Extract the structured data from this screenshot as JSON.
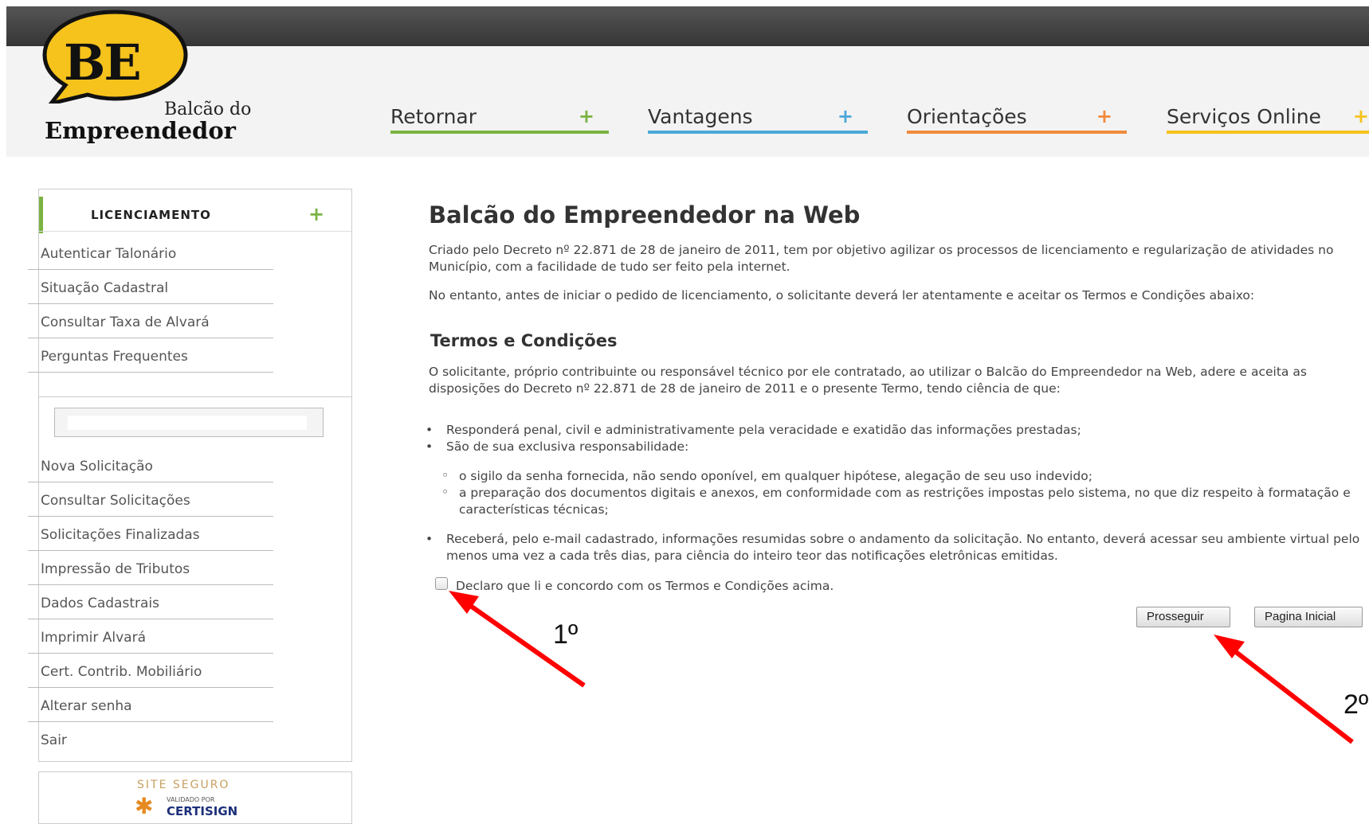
{
  "brand": {
    "logo_mark": "BE",
    "logo_line1": "Balcão do",
    "logo_line2": "Empreendedor",
    "bubble_color": "#f6c21c"
  },
  "nav": [
    {
      "label": "Retornar",
      "color": "#7ab342"
    },
    {
      "label": "Vantagens",
      "color": "#4aa8d8"
    },
    {
      "label": "Orientações",
      "color": "#f08a3b"
    },
    {
      "label": "Serviços Online",
      "color": "#f6c21c"
    }
  ],
  "nav_plus": "+",
  "sidebar": {
    "section_title": "LICENCIAMENTO",
    "section_plus": "+",
    "items_top": [
      "Autenticar Talonário",
      "Situação Cadastral",
      "Consultar Taxa de Alvará",
      "Perguntas Frequentes"
    ],
    "items_bottom": [
      "Nova Solicitação",
      "Consultar Solicitações",
      "Solicitações Finalizadas",
      "Impressão de Tributos",
      "Dados Cadastrais",
      "Imprimir Alvará",
      "Cert. Contrib. Mobiliário",
      "Alterar senha",
      "Sair"
    ],
    "seal_line1": "SITE SEGURO",
    "seal_line2": "VALIDADO POR",
    "seal_line3": "CERTISIGN"
  },
  "main": {
    "title": "Balcão do Empreendedor na Web",
    "para1": "Criado pelo Decreto nº 22.871 de 28 de janeiro de 2011, tem por objetivo agilizar os processos de licenciamento e regularização de atividades no Município, com a facilidade de tudo ser feito pela internet.",
    "para2": "No entanto, antes de iniciar o pedido de licenciamento, o solicitante deverá ler atentamente e aceitar os Termos e Condições abaixo:",
    "terms_title": "Termos e Condições",
    "para3": "O solicitante, próprio contribuinte ou responsável técnico por ele contratado, ao utilizar o Balcão do Empreendedor na Web, adere e aceita as disposições do Decreto nº 22.871 de 28 de janeiro de 2011 e o presente Termo, tendo ciência de que:",
    "bullet1": "Responderá penal, civil e administrativamente pela veracidade e exatidão das informações prestadas;",
    "bullet2": "São de sua exclusiva responsabilidade:",
    "sub1": "o sigilo da senha fornecida, não sendo oponível, em qualquer hipótese, alegação de seu uso indevido;",
    "sub2": "a preparação dos documentos digitais e anexos, em conformidade com as restrições impostas pelo sistema, no que diz respeito à formatação e características técnicas;",
    "bullet3": "Receberá, pelo e-mail cadastrado, informações resumidas sobre o andamento da solicitação. No entanto, deverá acessar seu ambiente virtual pelo menos uma vez a cada três dias, para ciência do inteiro teor das notificações eletrônicas emitidas.",
    "checkbox_label": "Declaro que li e concordo com os Termos e Condições acima.",
    "checkbox_checked": false,
    "btn_continue": "Prosseguir",
    "btn_home": "Pagina Inicial"
  },
  "annotations": {
    "step1": "1º",
    "step2": "2º",
    "arrow_color": "#ff0000"
  }
}
